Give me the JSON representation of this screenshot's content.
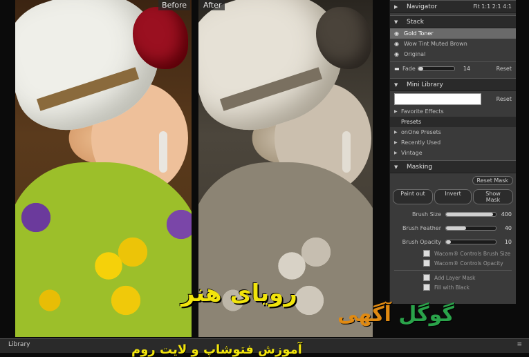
{
  "before_label": "Before",
  "after_label": "After",
  "navigator": {
    "title": "Navigator",
    "zoom_options": "Fit 1:1 2:1 4:1"
  },
  "stack": {
    "title": "Stack",
    "items": [
      {
        "label": "Gold Toner",
        "selected": true
      },
      {
        "label": "Wow Tint Muted Brown",
        "selected": false
      },
      {
        "label": "Original",
        "selected": false
      }
    ],
    "fade_label": "Fade",
    "fade_value": "14",
    "fade_level": 0.14,
    "reset_label": "Reset"
  },
  "mini_library": {
    "title": "Mini Library",
    "search_value": "",
    "reset_label": "Reset",
    "items": [
      "Favorite Effects",
      "Presets",
      "onOne Presets",
      "Recently Used",
      "Vintage"
    ]
  },
  "masking": {
    "title": "Masking",
    "reset_mask": "Reset Mask",
    "paint_out": "Paint out",
    "invert": "Invert",
    "show_mask": "Show Mask",
    "sliders": [
      {
        "label": "Brush Size",
        "value": "400",
        "level": 0.95
      },
      {
        "label": "Brush Feather",
        "value": "40",
        "level": 0.4
      },
      {
        "label": "Brush Opacity",
        "value": "10",
        "level": 0.1
      }
    ],
    "checkboxes": [
      "Wacom® Controls Brush Size",
      "Wacom® Controls Opacity",
      "Add Layer Mask",
      "Fill with Black"
    ]
  },
  "library_bar": {
    "title": "Library",
    "grip": "≡"
  },
  "watermark": {
    "title": "رویای هنر",
    "brand_a": "گوگل",
    "brand_b": "آگهی",
    "bottom": "آموزش فتوشاپ و لایت روم"
  }
}
